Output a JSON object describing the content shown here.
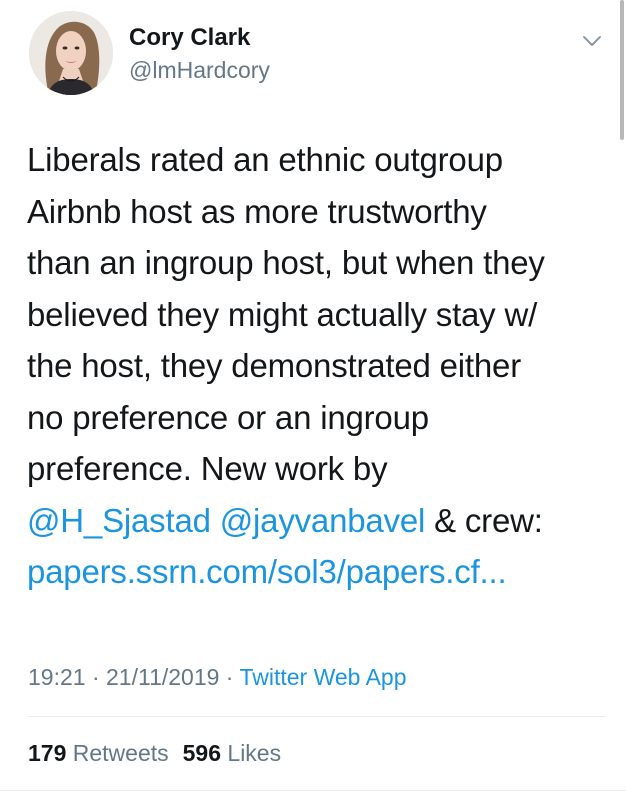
{
  "author": {
    "name": "Cory Clark",
    "handle": "@lmHardcory",
    "avatar_icon": "profile-photo"
  },
  "tweet": {
    "lines": [
      {
        "text": "Liberals rated an ethnic outgroup"
      },
      {
        "text": "Airbnb host as more trustworthy"
      },
      {
        "text": "than an ingroup host, but when they"
      },
      {
        "text": "believed they might actually stay w/"
      },
      {
        "text": "the host, they demonstrated either"
      },
      {
        "text": "no preference or an ingroup"
      },
      {
        "text": "preference. New work by"
      }
    ],
    "mention_1": "@H_Sjastad",
    "mention_2": "@jayvanbavel",
    "mention_suffix": " & crew:",
    "link": "papers.ssrn.com/sol3/papers.cf..."
  },
  "meta": {
    "time": "19:21",
    "date": "21/11/2019",
    "separator": " · ",
    "source": "Twitter Web App"
  },
  "stats": {
    "retweets_count": "179",
    "retweets_label": "Retweets",
    "likes_count": "596",
    "likes_label": "Likes"
  },
  "colors": {
    "link": "#1b95e0",
    "secondary_text": "#657786",
    "primary_text": "#14171a"
  },
  "icons": {
    "menu": "chevron-down-icon"
  }
}
